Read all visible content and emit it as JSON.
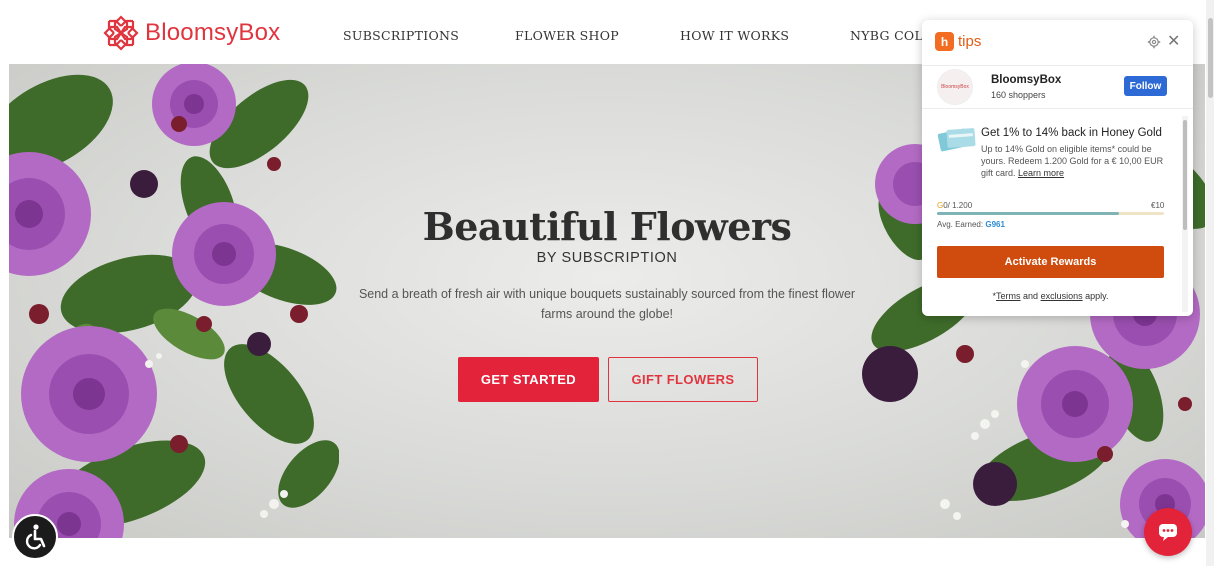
{
  "header": {
    "brand": "BloomsyBox",
    "nav": [
      "SUBSCRIPTIONS",
      "FLOWER SHOP",
      "HOW IT WORKS",
      "NYBG COLL"
    ]
  },
  "hero": {
    "title": "Beautiful Flowers",
    "subtitle": "BY SUBSCRIPTION",
    "description": "Send a breath of fresh air with unique bouquets sustainably sourced from the finest flower farms around the globe!",
    "primary_button": "GET STARTED",
    "secondary_button": "GIFT FLOWERS"
  },
  "honey": {
    "logo_glyph": "h",
    "title": "tips",
    "close_glyph": "✕",
    "store": {
      "avatar_text": "BloomsyBox",
      "name": "BloomsyBox",
      "shoppers": "160 shoppers",
      "follow_label": "Follow"
    },
    "gold": {
      "title": "Get 1% to 14% back in Honey Gold",
      "description": "Up to 14% Gold on eligible items* could be yours. Redeem 1.200 Gold for a € 10,00 EUR gift card.",
      "learn_more": "Learn more",
      "progress_start_symbol": "G",
      "progress_start": "0/ 1.200",
      "progress_end": "€10",
      "progress_fraction": 0.8,
      "avg_label": "Avg. Earned:",
      "avg_value": "G961",
      "activate_label": "Activate Rewards",
      "terms_prefix": "*",
      "terms_link": "Terms",
      "terms_and": " and ",
      "exclusions_link": "exclusions",
      "terms_suffix": " apply."
    }
  },
  "colors": {
    "brand_red": "#e0353f",
    "honey_orange": "#cf4c0e",
    "follow_blue": "#2d6ad6"
  },
  "icons": {
    "accessibility": "accessibility-icon",
    "chat": "chat-icon",
    "settings": "gear-icon",
    "close": "close-icon"
  }
}
